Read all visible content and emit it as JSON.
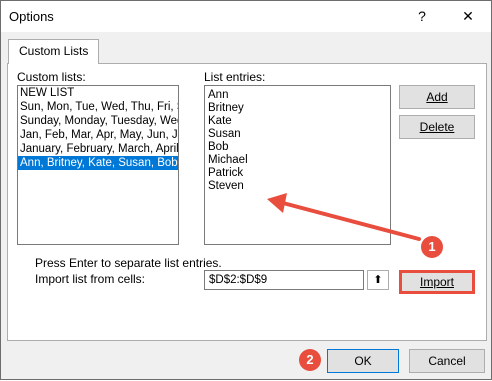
{
  "window": {
    "title": "Options",
    "help": "?",
    "close": "✕"
  },
  "tab": {
    "label": "Custom Lists"
  },
  "custom_lists": {
    "label": "Custom lists:",
    "items": [
      "NEW LIST",
      "Sun, Mon, Tue, Wed, Thu, Fri, S",
      "Sunday, Monday, Tuesday, Wed",
      "Jan, Feb, Mar, Apr, May, Jun, Ju",
      "January, February, March, April",
      "Ann, Britney, Kate, Susan, Bob,"
    ],
    "selected_index": 5
  },
  "list_entries": {
    "label": "List entries:",
    "items": [
      "Ann",
      "Britney",
      "Kate",
      "Susan",
      "Bob",
      "Michael",
      "Patrick",
      "Steven"
    ]
  },
  "buttons": {
    "add": "Add",
    "delete": "Delete",
    "import": "Import",
    "ok": "OK",
    "cancel": "Cancel"
  },
  "hint": "Press Enter to separate list entries.",
  "import_from": {
    "label": "Import list from cells:",
    "value": "$D$2:$D$9",
    "collapse_icon": "⬆"
  },
  "annotations": {
    "step1": "1",
    "step2": "2",
    "color": "#e84d3d"
  }
}
